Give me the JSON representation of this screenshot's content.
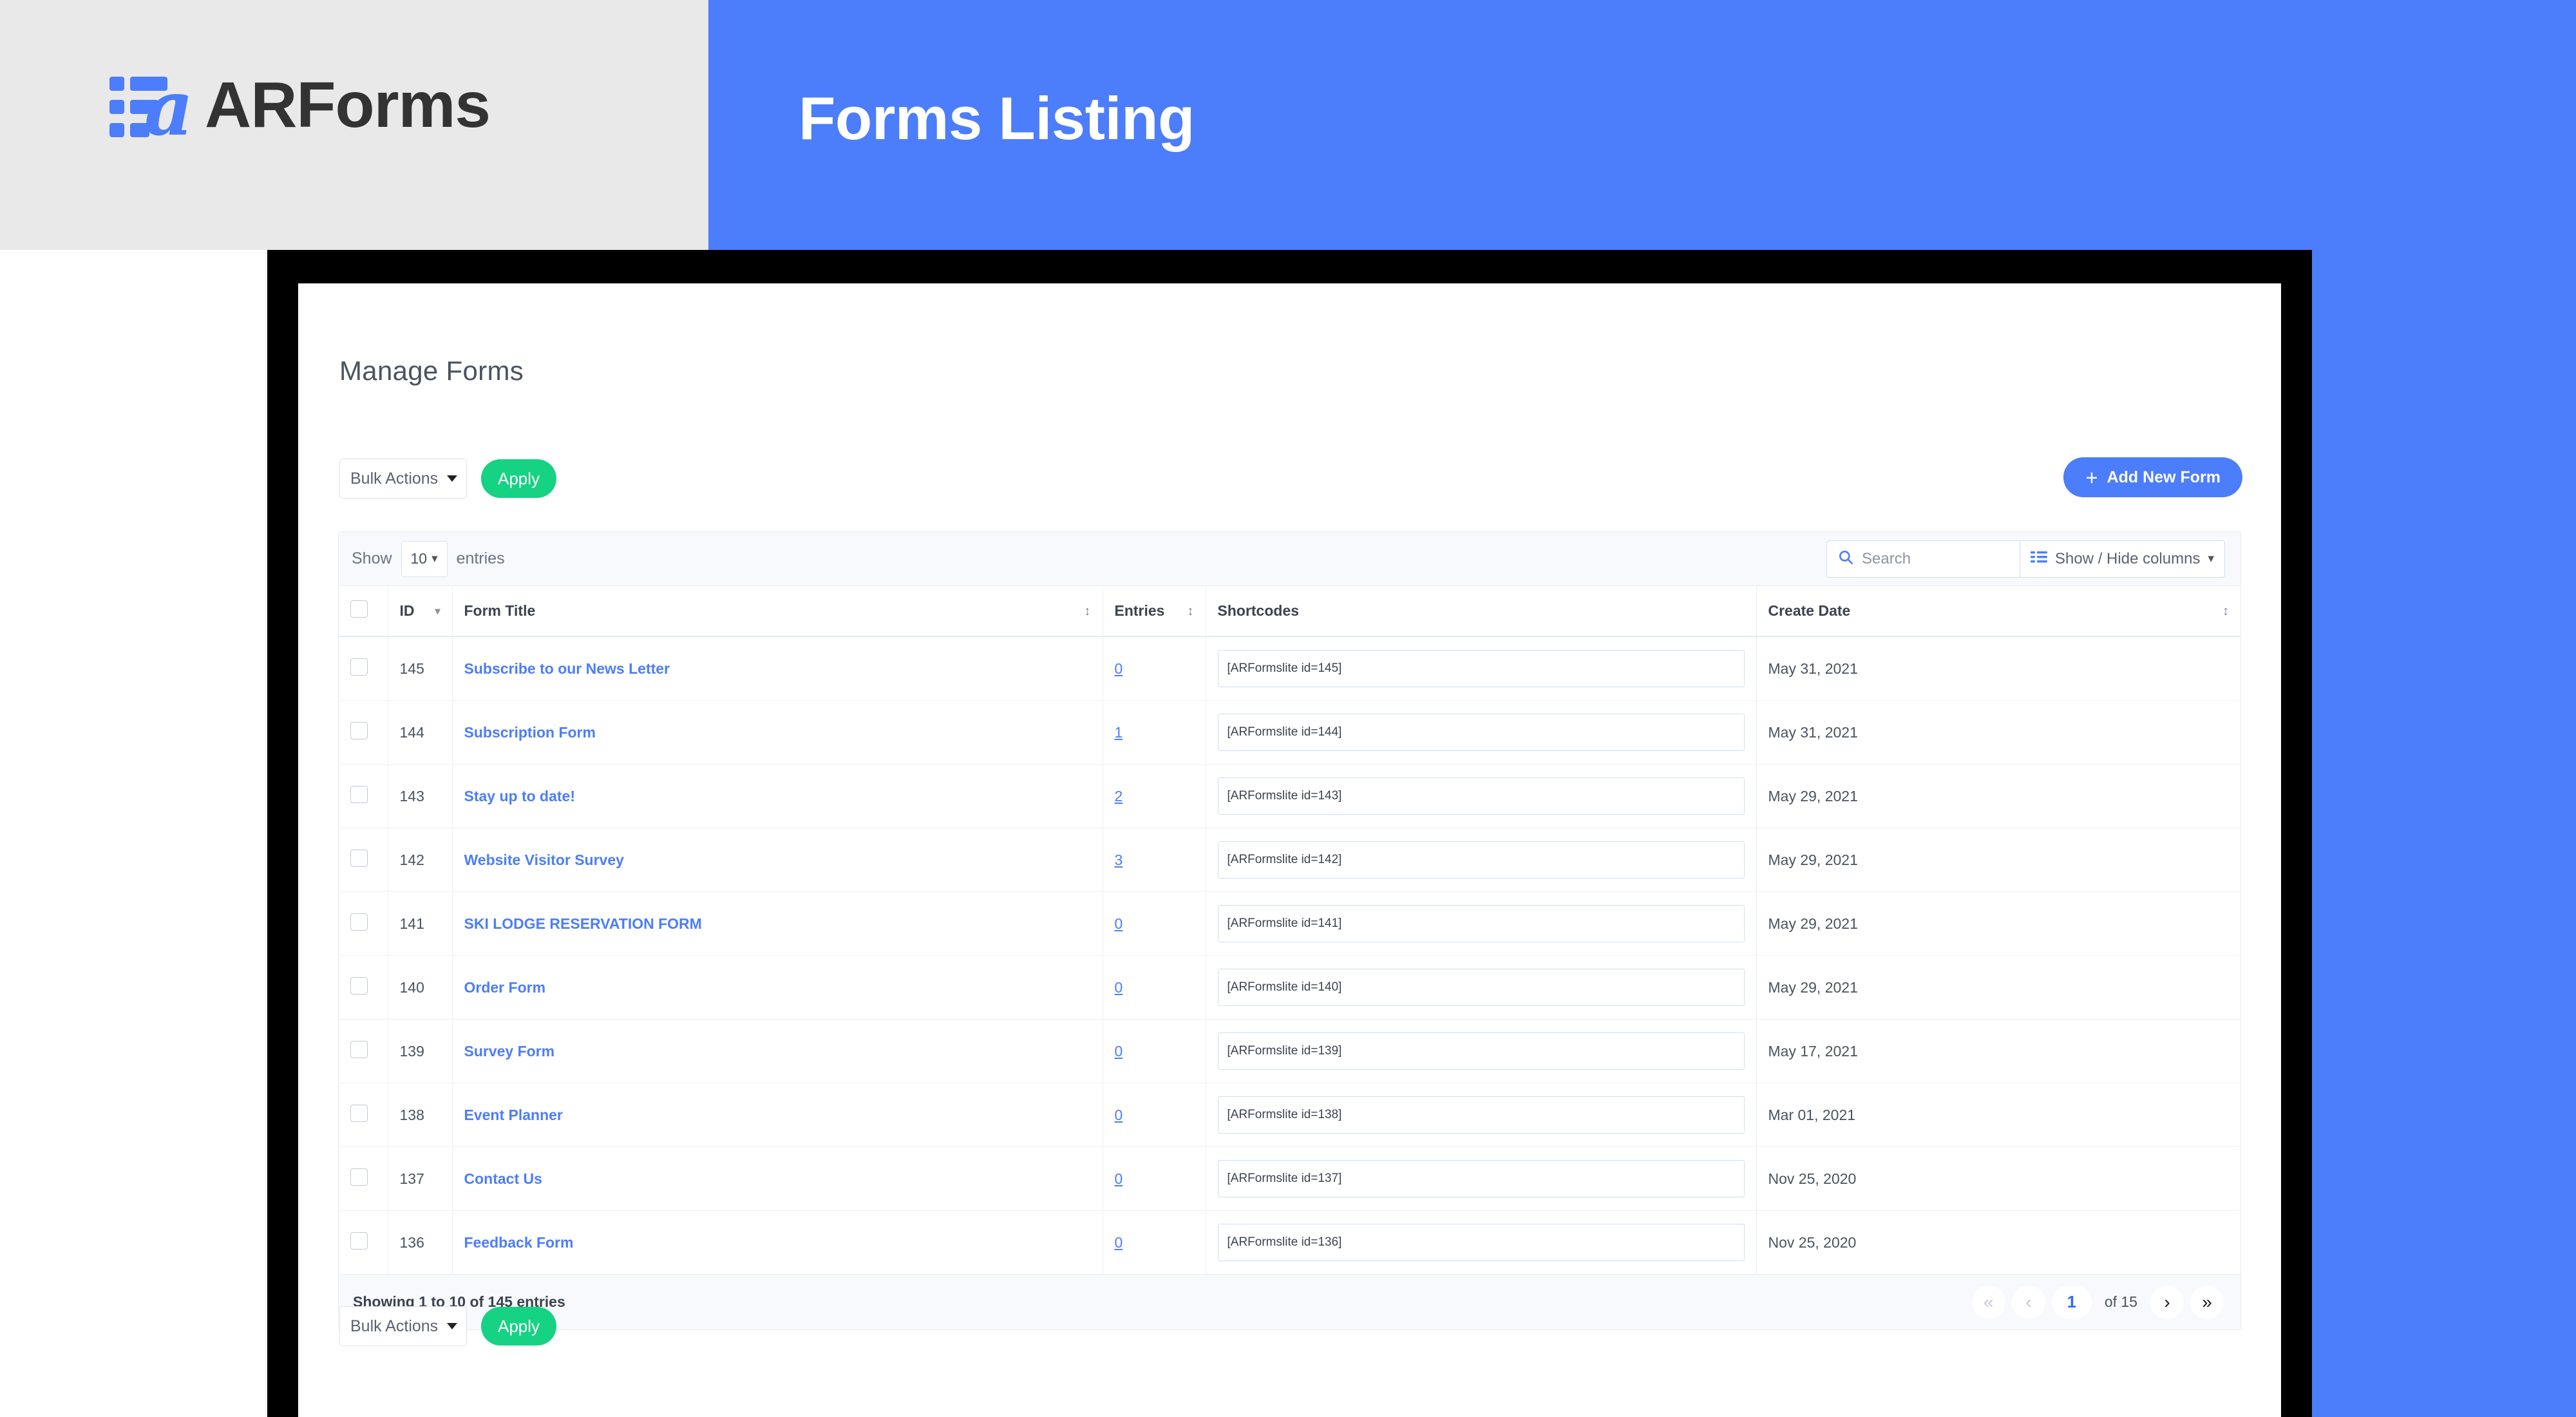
{
  "brand": {
    "logo_text": "ARForms",
    "logo_icon": "arforms-bars-a-icon",
    "accent_blue": "#4c7dfa",
    "accent_green": "#16d283",
    "banner_left_bg": "#e9e9e9"
  },
  "banner": {
    "title": "Forms Listing"
  },
  "page": {
    "title": "Manage Forms"
  },
  "toolbar": {
    "bulk_actions_label": "Bulk Actions",
    "apply_label": "Apply",
    "add_new_form_label": "Add New Form",
    "add_new_form_plus": "+"
  },
  "datatable_controls": {
    "show_label": "Show",
    "page_length": "10",
    "entries_label": "entries",
    "search_placeholder": "Search",
    "search_value": "",
    "show_hide_columns_label": "Show / Hide columns"
  },
  "table": {
    "columns": [
      {
        "key": "checkbox",
        "label": "",
        "sort": "none"
      },
      {
        "key": "id",
        "label": "ID",
        "sort": "desc"
      },
      {
        "key": "form_title",
        "label": "Form Title",
        "sort": "both"
      },
      {
        "key": "entries",
        "label": "Entries",
        "sort": "both"
      },
      {
        "key": "shortcodes",
        "label": "Shortcodes",
        "sort": "none"
      },
      {
        "key": "create_date",
        "label": "Create Date",
        "sort": "both"
      }
    ],
    "rows": [
      {
        "id": "145",
        "form_title": "Subscribe to our News Letter",
        "entries": "0",
        "shortcode": "[ARFormslite id=145]",
        "create_date": "May 31, 2021"
      },
      {
        "id": "144",
        "form_title": "Subscription Form",
        "entries": "1",
        "shortcode": "[ARFormslite id=144]",
        "create_date": "May 31, 2021"
      },
      {
        "id": "143",
        "form_title": "Stay up to date!",
        "entries": "2",
        "shortcode": "[ARFormslite id=143]",
        "create_date": "May 29, 2021"
      },
      {
        "id": "142",
        "form_title": "Website Visitor Survey",
        "entries": "3",
        "shortcode": "[ARFormslite id=142]",
        "create_date": "May 29, 2021"
      },
      {
        "id": "141",
        "form_title": "SKI LODGE RESERVATION FORM",
        "entries": "0",
        "shortcode": "[ARFormslite id=141]",
        "create_date": "May 29, 2021"
      },
      {
        "id": "140",
        "form_title": "Order Form",
        "entries": "0",
        "shortcode": "[ARFormslite id=140]",
        "create_date": "May 29, 2021"
      },
      {
        "id": "139",
        "form_title": "Survey Form",
        "entries": "0",
        "shortcode": "[ARFormslite id=139]",
        "create_date": "May 17, 2021"
      },
      {
        "id": "138",
        "form_title": "Event Planner",
        "entries": "0",
        "shortcode": "[ARFormslite id=138]",
        "create_date": "Mar 01, 2021"
      },
      {
        "id": "137",
        "form_title": "Contact Us",
        "entries": "0",
        "shortcode": "[ARFormslite id=137]",
        "create_date": "Nov 25, 2020"
      },
      {
        "id": "136",
        "form_title": "Feedback Form",
        "entries": "0",
        "shortcode": "[ARFormslite id=136]",
        "create_date": "Nov 25, 2020"
      }
    ]
  },
  "footer": {
    "info": "Showing 1 to 10 of 145 entries",
    "pagination": {
      "first_label": "«",
      "prev_label": "‹",
      "current_page": "1",
      "of_label": "of 15",
      "next_label": "›",
      "last_label": "»"
    }
  }
}
